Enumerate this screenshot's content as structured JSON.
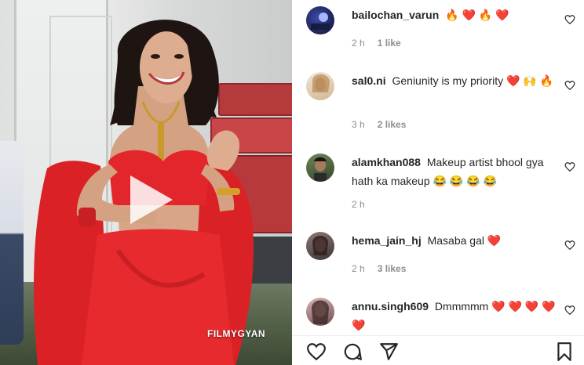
{
  "media": {
    "watermark": "FILMYGYAN",
    "play_button": "play-icon"
  },
  "comments": [
    {
      "username": "bailochan_varun",
      "text": "🔥 ❤️ 🔥 ❤️",
      "time": "2 h",
      "likes": "1 like"
    },
    {
      "username": "sal0.ni",
      "text": "Geniunity is my priority ❤️ 🙌 🔥",
      "time": "3 h",
      "likes": "2 likes"
    },
    {
      "username": "alamkhan088",
      "text": "Makeup artist bhool gya hath ka makeup 😂 😂 😂 😂",
      "time": "2 h",
      "likes": ""
    },
    {
      "username": "hema_jain_hj",
      "text": "Masaba gal ❤️",
      "time": "2 h",
      "likes": "3 likes"
    },
    {
      "username": "annu.singh609",
      "text": "Dmmmmm ❤️ ❤️ ❤️ ❤️ ❤️",
      "time": "",
      "likes": ""
    }
  ],
  "actions": {
    "like": "heart-icon",
    "comment": "comment-icon",
    "share": "share-icon",
    "save": "bookmark-icon"
  },
  "colors": {
    "text": "#262626",
    "secondary": "#8e8e8e",
    "heart": "#ed4956",
    "dress": "#e3262b"
  }
}
